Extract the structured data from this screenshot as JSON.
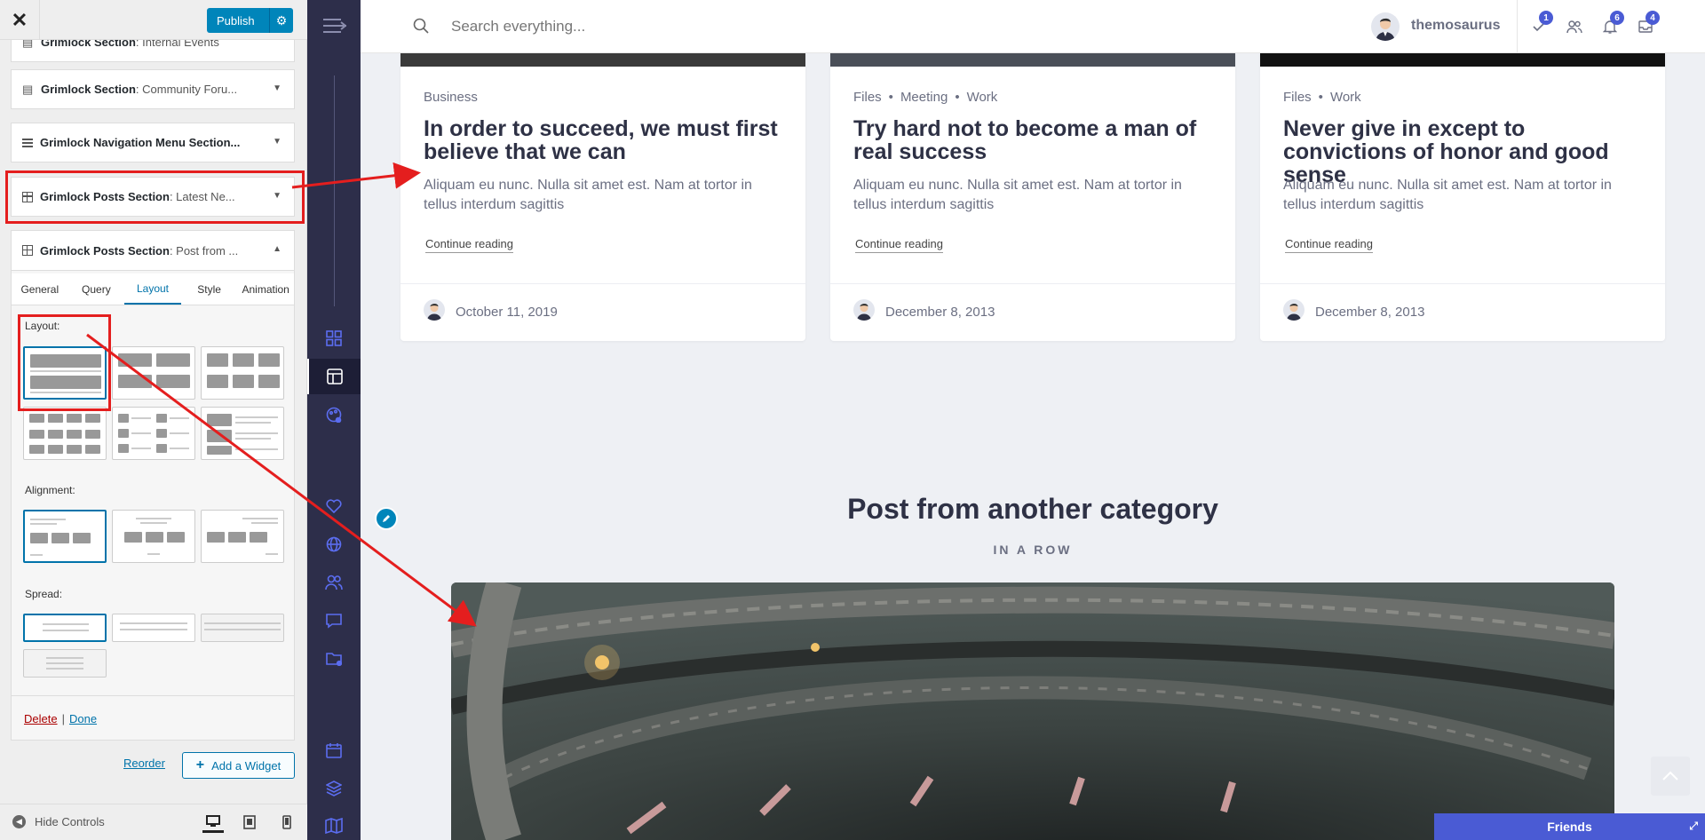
{
  "customizer": {
    "publish_label": "Publish",
    "sections": [
      {
        "name": "Grimlock Section",
        "sub": ": Internal Events"
      },
      {
        "name": "Grimlock Section",
        "sub": ": Community Foru..."
      },
      {
        "name": "Grimlock Navigation Menu Section...",
        "sub": ""
      },
      {
        "name": "Grimlock Posts Section",
        "sub": ": Latest Ne..."
      }
    ],
    "open_widget": {
      "name": "Grimlock Posts Section",
      "sub": ": Post from ...",
      "tabs": [
        "General",
        "Query",
        "Layout",
        "Style",
        "Animation"
      ],
      "active_tab": "Layout",
      "layout_label": "Layout:",
      "alignment_label": "Alignment:",
      "spread_label": "Spread:",
      "delete_label": "Delete",
      "separator": "|",
      "done_label": "Done"
    },
    "reorder_label": "Reorder",
    "add_widget_label": "Add a Widget",
    "hide_controls_label": "Hide Controls"
  },
  "topbar": {
    "search_placeholder": "Search everything...",
    "username": "themosaurus",
    "badges": {
      "tasks": "1",
      "notifications": "6",
      "messages": "4"
    }
  },
  "posts": [
    {
      "cats": [
        "Business"
      ],
      "title": "In order to succeed, we must first believe that we can",
      "excerpt": "Aliquam eu nunc. Nulla sit amet est. Nam at tortor in tellus interdum sagittis",
      "more": "Continue reading",
      "date": "October 11, 2019"
    },
    {
      "cats": [
        "Files",
        "Meeting",
        "Work"
      ],
      "title": "Try hard not to become a man of real success",
      "excerpt": "Aliquam eu nunc. Nulla sit amet est. Nam at tortor in tellus interdum sagittis",
      "more": "Continue reading",
      "date": "December 8, 2013"
    },
    {
      "cats": [
        "Files",
        "Work"
      ],
      "title": "Never give in except to convictions of honor and good sense",
      "excerpt": "Aliquam eu nunc. Nulla sit amet est. Nam at tortor in tellus interdum sagittis",
      "more": "Continue reading",
      "date": "December 8, 2013"
    }
  ],
  "section": {
    "title": "Post from another category",
    "subtitle": "IN A ROW"
  },
  "friends_label": "Friends",
  "colors": {
    "accent": "#4a5bd4",
    "wp_blue": "#0085ba",
    "rail": "#2d2e4a",
    "annotation_red": "#e41e1e"
  }
}
